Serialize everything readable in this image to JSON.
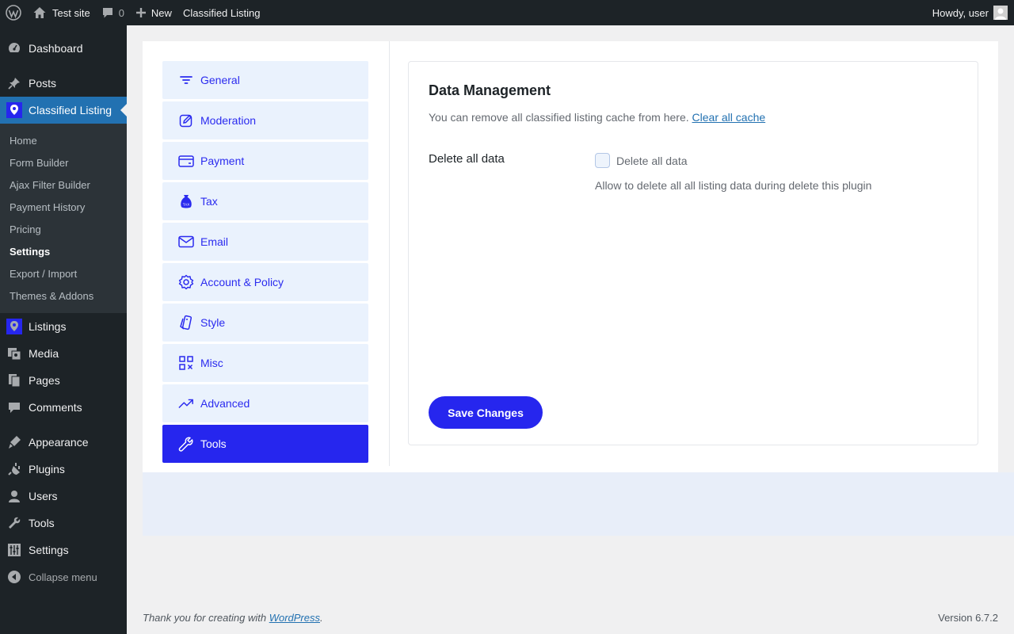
{
  "adminbar": {
    "site_name": "Test site",
    "comments_count": "0",
    "new_label": "New",
    "plugin_link": "Classified Listing",
    "howdy": "Howdy, user"
  },
  "sidebar": {
    "items_top": [
      {
        "label": "Dashboard",
        "icon": "dashboard-icon"
      },
      {
        "label": "Posts",
        "icon": "pin-icon"
      },
      {
        "label": "Classified Listing",
        "icon": "classified-listing-icon"
      }
    ],
    "submenu": [
      {
        "label": "Home"
      },
      {
        "label": "Form Builder"
      },
      {
        "label": "Ajax Filter Builder"
      },
      {
        "label": "Payment History"
      },
      {
        "label": "Pricing"
      },
      {
        "label": "Settings"
      },
      {
        "label": "Export / Import"
      },
      {
        "label": "Themes & Addons"
      }
    ],
    "items_bottom": [
      {
        "label": "Listings",
        "icon": "listings-icon"
      },
      {
        "label": "Media",
        "icon": "media-icon"
      },
      {
        "label": "Pages",
        "icon": "pages-icon"
      },
      {
        "label": "Comments",
        "icon": "comments-icon"
      },
      {
        "label": "Appearance",
        "icon": "appearance-icon"
      },
      {
        "label": "Plugins",
        "icon": "plugins-icon"
      },
      {
        "label": "Users",
        "icon": "users-icon"
      },
      {
        "label": "Tools",
        "icon": "tools-icon"
      },
      {
        "label": "Settings",
        "icon": "settings-icon"
      }
    ],
    "collapse_label": "Collapse menu"
  },
  "tabs": [
    {
      "label": "General",
      "icon": "filter-icon"
    },
    {
      "label": "Moderation",
      "icon": "edit-icon"
    },
    {
      "label": "Payment",
      "icon": "credit-card-icon"
    },
    {
      "label": "Tax",
      "icon": "tax-bag-icon"
    },
    {
      "label": "Email",
      "icon": "envelope-icon"
    },
    {
      "label": "Account & Policy",
      "icon": "gear-icon"
    },
    {
      "label": "Style",
      "icon": "style-icon"
    },
    {
      "label": "Misc",
      "icon": "qr-grid-icon"
    },
    {
      "label": "Advanced",
      "icon": "trend-up-icon"
    },
    {
      "label": "Tools",
      "icon": "wrench-icon"
    }
  ],
  "active_tab": "Tools",
  "panel": {
    "title": "Data Management",
    "desc_text": "You can remove all classified listing cache from here.",
    "desc_link": "Clear all cache",
    "field_label": "Delete all data",
    "checkbox_label": "Delete all data",
    "checkbox_checked": false,
    "help_text": "Allow to delete all all listing data during delete this plugin",
    "save_label": "Save Changes"
  },
  "footer": {
    "thanks_prefix": "Thank you for creating with ",
    "thanks_link": "WordPress",
    "thanks_suffix": ".",
    "version": "Version 6.7.2"
  },
  "colors": {
    "accent": "#2626ee",
    "tab_bg": "#eaf2fd",
    "admin_dark": "#1d2327",
    "wp_blue": "#2271b1"
  }
}
